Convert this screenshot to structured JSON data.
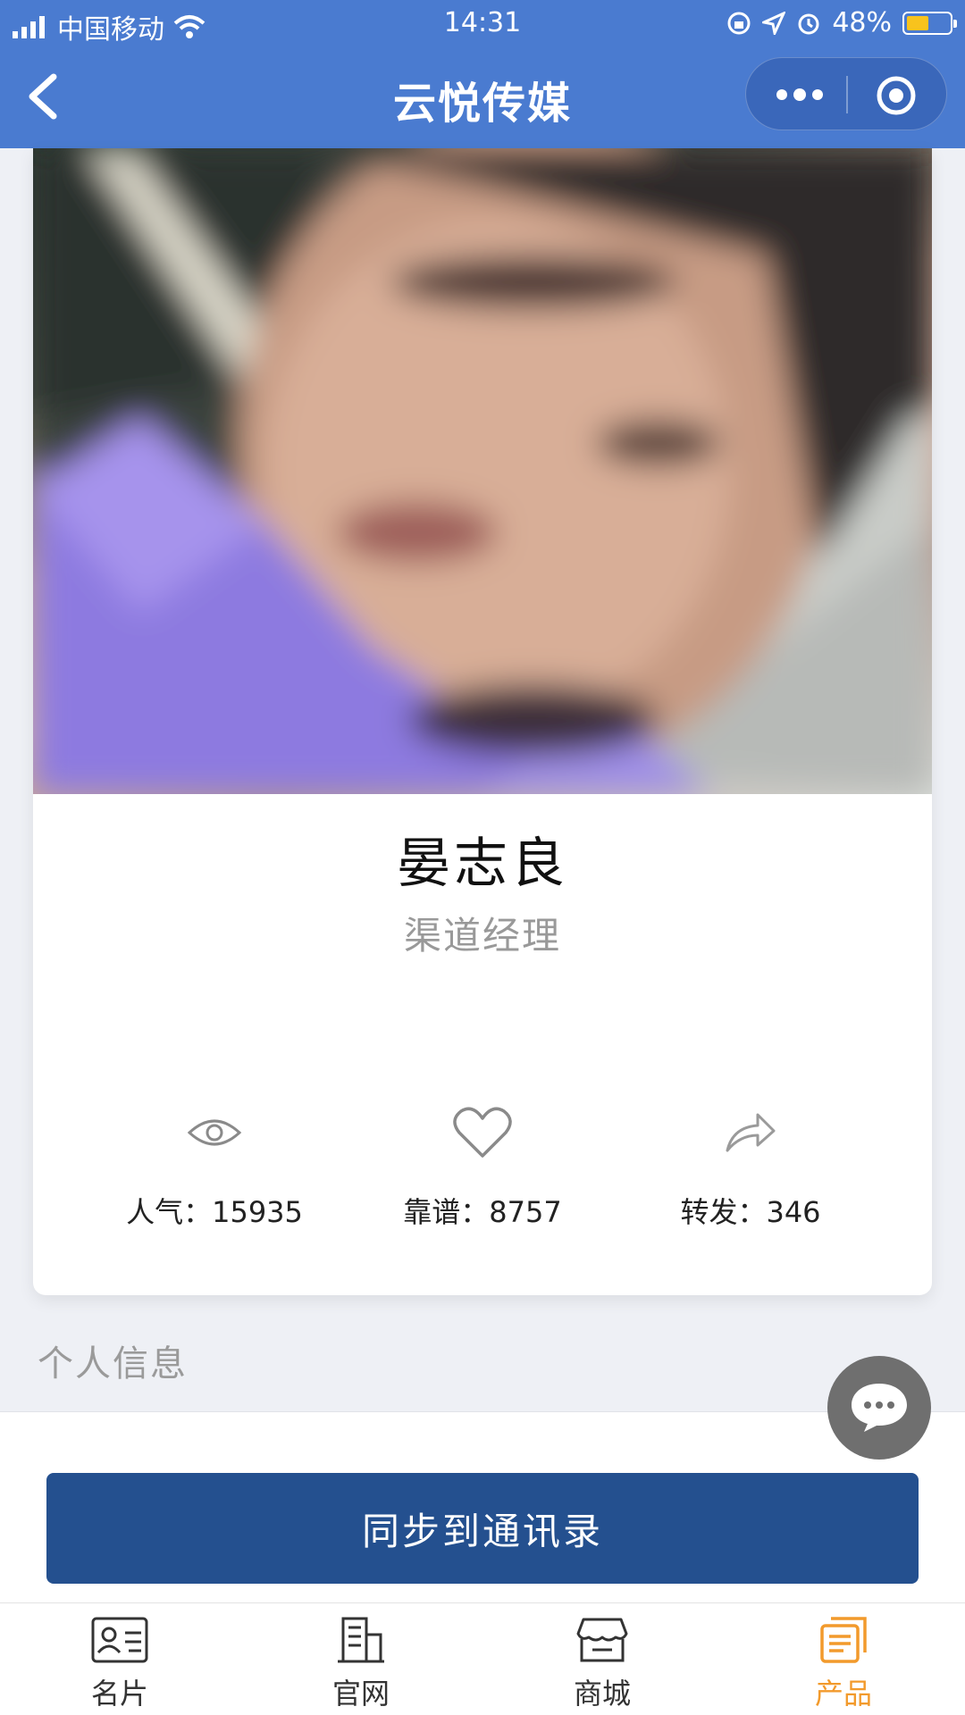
{
  "status_bar": {
    "carrier": "中国移动",
    "time": "14:31",
    "battery": "48%",
    "battery_level": 0.48
  },
  "nav": {
    "title": "云悦传媒"
  },
  "profile": {
    "name": "晏志良",
    "title": "渠道经理"
  },
  "stats": [
    {
      "icon": "eye-icon",
      "label": "人气：15935"
    },
    {
      "icon": "heart-icon",
      "label": "靠谱：8757"
    },
    {
      "icon": "share-icon",
      "label": "转发：346"
    }
  ],
  "section": {
    "info_label": "个人信息"
  },
  "actions": {
    "sync_label": "同步到通讯录"
  },
  "tabbar": {
    "items": [
      {
        "label": "名片",
        "icon": "card-icon"
      },
      {
        "label": "官网",
        "icon": "building-icon"
      },
      {
        "label": "商城",
        "icon": "store-icon"
      },
      {
        "label": "产品",
        "icon": "product-icon"
      }
    ],
    "active_index": 3,
    "active_color": "#f29a2c"
  },
  "colors": {
    "nav_bg": "#4a7bd0",
    "button_bg": "#24508f"
  }
}
